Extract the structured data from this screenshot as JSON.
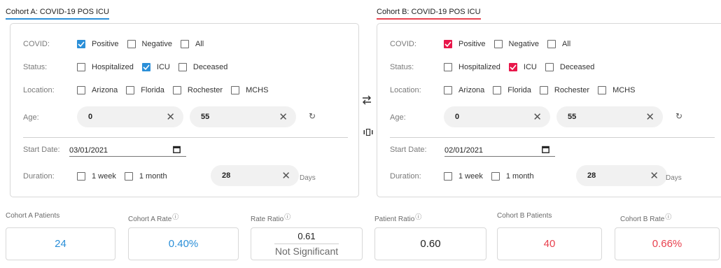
{
  "cohort_a": {
    "title": "Cohort A: COVID-19 POS ICU",
    "covid_label": "COVID:",
    "covid_options": [
      {
        "label": "Positive",
        "checked": true
      },
      {
        "label": "Negative",
        "checked": false
      },
      {
        "label": "All",
        "checked": false
      }
    ],
    "status_label": "Status:",
    "status_options": [
      {
        "label": "Hospitalized",
        "checked": false
      },
      {
        "label": "ICU",
        "checked": true
      },
      {
        "label": "Deceased",
        "checked": false
      }
    ],
    "location_label": "Location:",
    "location_options": [
      {
        "label": "Arizona",
        "checked": false
      },
      {
        "label": "Florida",
        "checked": false
      },
      {
        "label": "Rochester",
        "checked": false
      },
      {
        "label": "MCHS",
        "checked": false
      }
    ],
    "age_label": "Age:",
    "age_min": "0",
    "age_max": "55",
    "start_date_label": "Start Date:",
    "start_date": "03/01/2021",
    "duration_label": "Duration:",
    "duration_options": [
      {
        "label": "1 week",
        "checked": false
      },
      {
        "label": "1 month",
        "checked": false
      }
    ],
    "duration_value": "28",
    "duration_unit": "Days"
  },
  "cohort_b": {
    "title": "Cohort B: COVID-19 POS ICU",
    "covid_label": "COVID:",
    "covid_options": [
      {
        "label": "Positive",
        "checked": true
      },
      {
        "label": "Negative",
        "checked": false
      },
      {
        "label": "All",
        "checked": false
      }
    ],
    "status_label": "Status:",
    "status_options": [
      {
        "label": "Hospitalized",
        "checked": false
      },
      {
        "label": "ICU",
        "checked": true
      },
      {
        "label": "Deceased",
        "checked": false
      }
    ],
    "location_label": "Location:",
    "location_options": [
      {
        "label": "Arizona",
        "checked": false
      },
      {
        "label": "Florida",
        "checked": false
      },
      {
        "label": "Rochester",
        "checked": false
      },
      {
        "label": "MCHS",
        "checked": false
      }
    ],
    "age_label": "Age:",
    "age_min": "0",
    "age_max": "55",
    "start_date_label": "Start Date:",
    "start_date": "02/01/2021",
    "duration_label": "Duration:",
    "duration_options": [
      {
        "label": "1 week",
        "checked": false
      },
      {
        "label": "1 month",
        "checked": false
      }
    ],
    "duration_value": "28",
    "duration_unit": "Days"
  },
  "icons": {
    "clear": "close-icon",
    "reset": "reset-icon",
    "calendar": "calendar-icon",
    "swap": "swap-arrows-icon",
    "compare": "compare-icon",
    "info": "info-icon"
  },
  "colors": {
    "cohort_a": "#2b8fd8",
    "cohort_b": "#e8414e",
    "checkbox_b": "#e8174a"
  },
  "metrics": {
    "cohort_a_patients_label": "Cohort A Patients",
    "cohort_a_patients": "24",
    "cohort_a_rate_label": "Cohort A Rate",
    "cohort_a_rate": "0.40%",
    "rate_ratio_label": "Rate Ratio",
    "rate_ratio": "0.61",
    "rate_ratio_significance": "Not Significant",
    "patient_ratio_label": "Patient Ratio",
    "patient_ratio": "0.60",
    "cohort_b_patients_label": "Cohort B Patients",
    "cohort_b_patients": "40",
    "cohort_b_rate_label": "Cohort B Rate",
    "cohort_b_rate": "0.66%"
  }
}
